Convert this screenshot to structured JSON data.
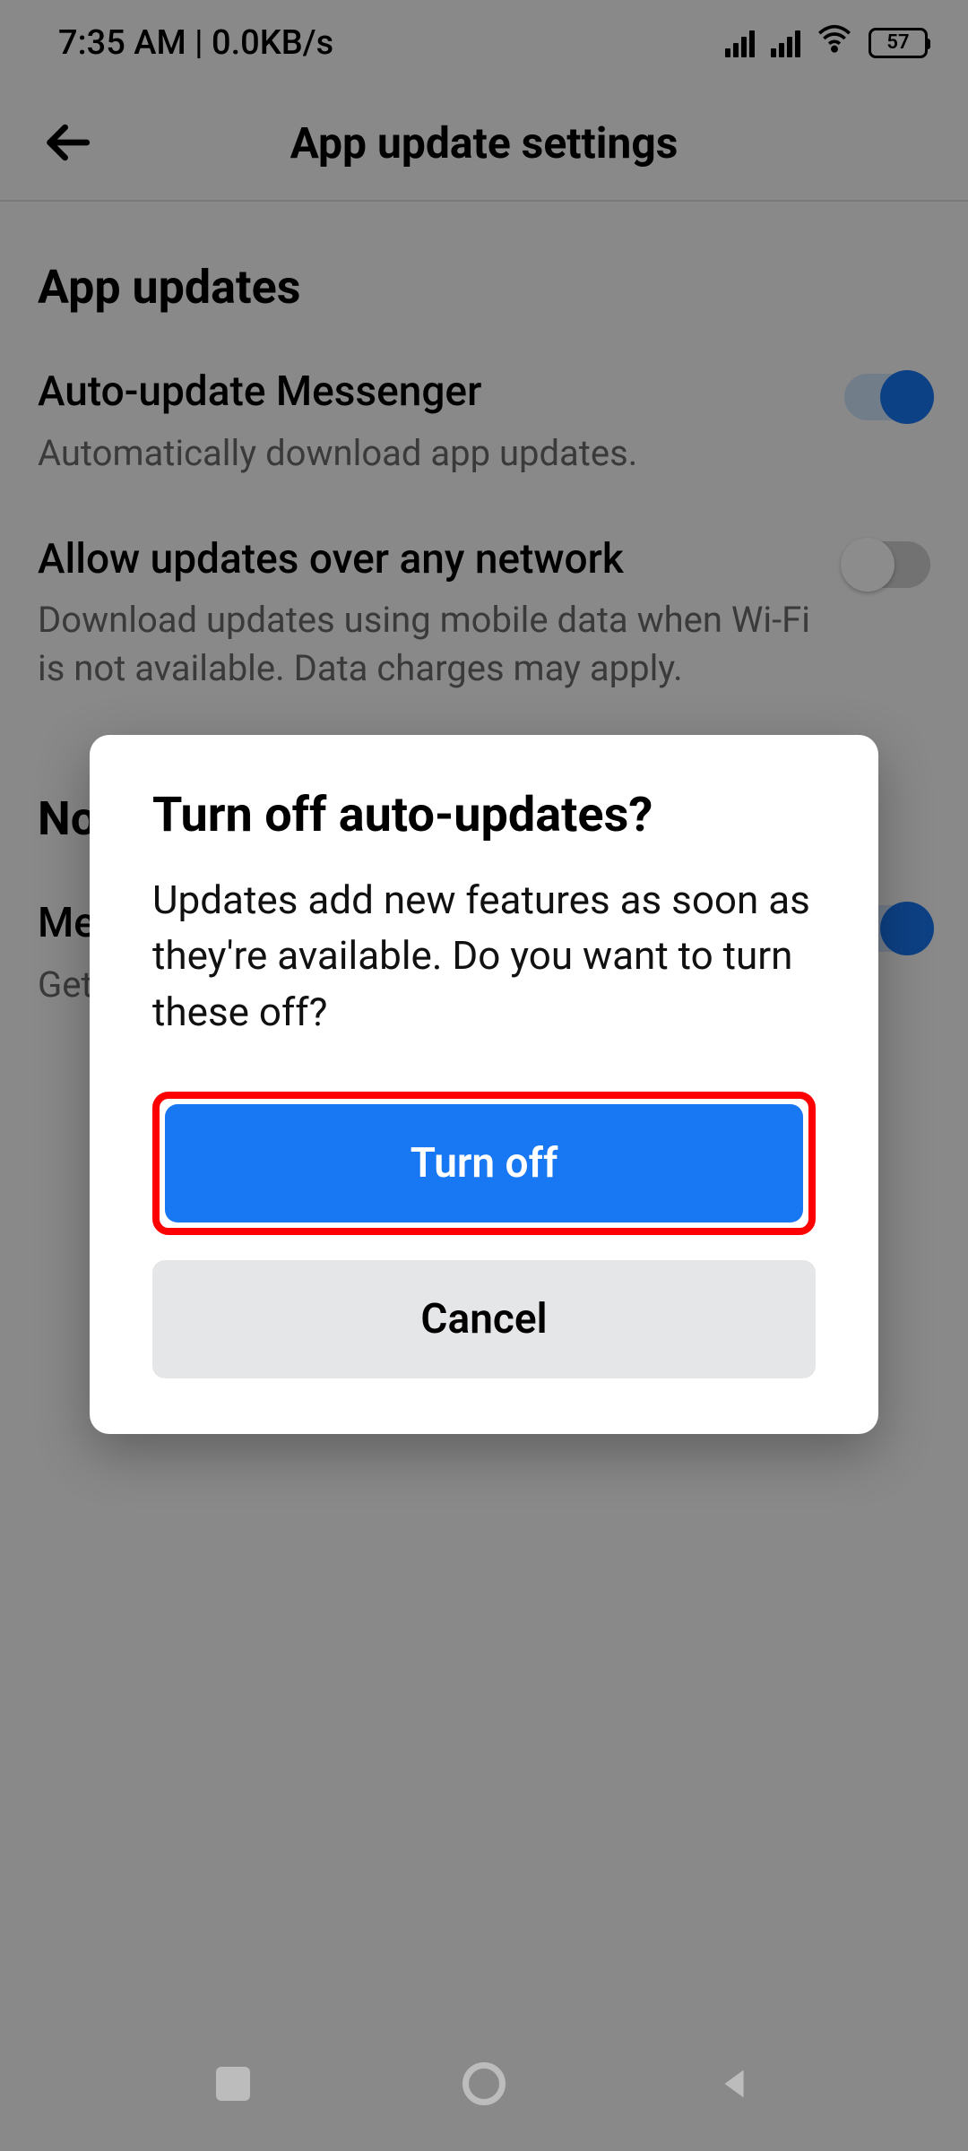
{
  "status": {
    "time_text": "7:35 AM | 0.0KB/s",
    "battery_percent": "57"
  },
  "appbar": {
    "title": "App update settings"
  },
  "sections": {
    "app_updates": {
      "title": "App updates",
      "auto_update": {
        "label": "Auto-update Messenger",
        "desc": "Automatically download app updates.",
        "on": true
      },
      "any_network": {
        "label": "Allow updates over any network",
        "desc": "Download updates using mobile data when Wi-Fi is not available. Data charges may apply.",
        "on": false
      }
    },
    "notifications": {
      "title": "Notifications",
      "updates_available": {
        "label": "Messenger updates available",
        "desc": "Get notified when updates are available.",
        "on": true
      }
    }
  },
  "dialog": {
    "title": "Turn off auto-updates?",
    "body": "Updates add new features as soon as they're available. Do you want to turn these off?",
    "primary_label": "Turn off",
    "secondary_label": "Cancel"
  }
}
